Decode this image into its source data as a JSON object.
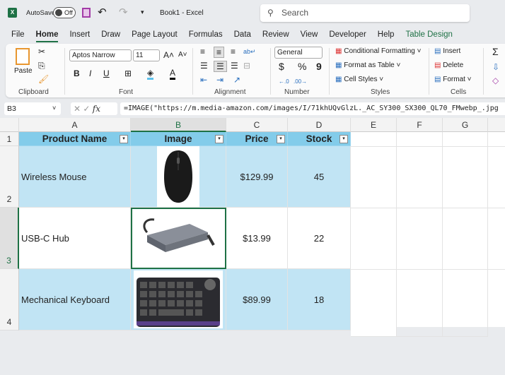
{
  "title_bar": {
    "autosave_label": "AutoSave",
    "autosave_state": "Off",
    "document_title": "Book1  -  Excel",
    "search_placeholder": "Search"
  },
  "tabs": [
    "File",
    "Home",
    "Insert",
    "Draw",
    "Page Layout",
    "Formulas",
    "Data",
    "Review",
    "View",
    "Developer",
    "Help",
    "Table Design"
  ],
  "ribbon": {
    "clipboard": {
      "paste": "Paste",
      "label": "Clipboard"
    },
    "font": {
      "name": "Aptos Narrow",
      "size": "11",
      "label": "Font",
      "bold": "B",
      "italic": "I",
      "underline": "U"
    },
    "alignment": {
      "label": "Alignment"
    },
    "number": {
      "format": "General",
      "currency": "$",
      "percent": "%",
      "comma": "9",
      "label": "Number"
    },
    "styles": {
      "conditional": "Conditional Formatting",
      "format_table": "Format as Table",
      "cell_styles": "Cell Styles",
      "label": "Styles"
    },
    "cells": {
      "insert": "Insert",
      "delete": "Delete",
      "format": "Format",
      "label": "Cells"
    }
  },
  "formula_bar": {
    "name_box": "B3",
    "fx": "fx",
    "formula": "=IMAGE(\"https://m.media-amazon.com/images/I/71khUQvGlzL._AC_SY300_SX300_QL70_FMwebp_.jpg"
  },
  "columns": [
    "A",
    "B",
    "C",
    "D",
    "E",
    "F",
    "G"
  ],
  "rows": [
    "1",
    "2",
    "3",
    "4"
  ],
  "table": {
    "headers": [
      "Product Name",
      "Image",
      "Price",
      "Stock"
    ],
    "data": [
      {
        "name": "Wireless Mouse",
        "image": "mouse",
        "price": "$129.99",
        "stock": "45"
      },
      {
        "name": "USB-C Hub",
        "image": "usb-hub",
        "price": "$13.99",
        "stock": "22"
      },
      {
        "name": "Mechanical Keyboard",
        "image": "keyboard",
        "price": "$89.99",
        "stock": "18"
      }
    ]
  },
  "colors": {
    "header": "#83ccea",
    "band": "#c1e4f4",
    "accent": "#1e7145"
  }
}
